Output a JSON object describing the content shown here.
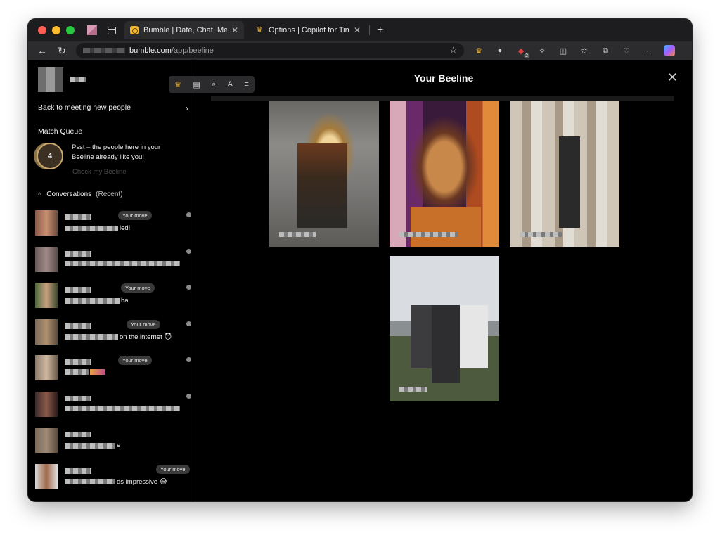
{
  "browser": {
    "tabs": [
      {
        "title": "Bumble | Date, Chat, Meet New",
        "active": true,
        "favicon": "bumble-favicon"
      },
      {
        "title": "Options | Copilot for Tinder & B",
        "active": false,
        "favicon": "copilot-extension-favicon"
      }
    ],
    "url": {
      "domain": "bumble.com",
      "path": "/app/beeline"
    },
    "extension_badge": "2"
  },
  "sidebar": {
    "back_label": "Back to meeting new people",
    "match_queue_title": "Match Queue",
    "queue_count": "4",
    "queue_text": "Psst – the people here in your Beeline already like you!",
    "queue_link": "Check my Beeline",
    "conversations_title": "Conversations",
    "conversations_filter": "(Recent)",
    "conversations": [
      {
        "message_suffix": "ied!",
        "your_move": "Your move",
        "emoji": ""
      },
      {
        "message_suffix": "",
        "your_move": "",
        "emoji": ""
      },
      {
        "message_suffix": "ha",
        "your_move": "Your move",
        "emoji": ""
      },
      {
        "message_suffix": "on the internet",
        "your_move": "Your move",
        "emoji": "😈"
      },
      {
        "message_suffix": "",
        "your_move": "Your move",
        "emoji": ""
      },
      {
        "message_suffix": "",
        "your_move": "",
        "emoji": ""
      },
      {
        "message_suffix": "e",
        "your_move": "",
        "emoji": ""
      },
      {
        "message_suffix": "ds impressive",
        "your_move": "Your move",
        "emoji": "😅"
      }
    ]
  },
  "main": {
    "title": "Your Beeline",
    "close_icon": "close-icon"
  },
  "colors": {
    "background": "#000000",
    "accent": "#f5b833",
    "badge_bg": "#3a3a3a"
  }
}
